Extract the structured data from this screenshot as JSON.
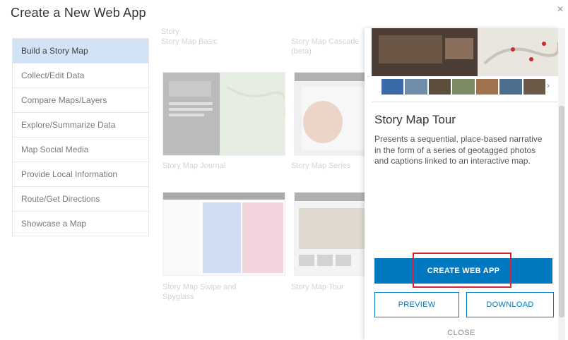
{
  "dialog": {
    "title": "Create a New Web App",
    "close_glyph": "✕"
  },
  "sidebar": {
    "items": [
      {
        "label": "Build a Story Map",
        "active": true
      },
      {
        "label": "Collect/Edit Data"
      },
      {
        "label": "Compare Maps/Layers"
      },
      {
        "label": "Explore/Summarize Data"
      },
      {
        "label": "Map Social Media"
      },
      {
        "label": "Provide Local Information"
      },
      {
        "label": "Route/Get Directions"
      },
      {
        "label": "Showcase a Map"
      }
    ]
  },
  "gallery": {
    "top_captions": [
      "Story Map Basic",
      "Story Map Cascade (beta)"
    ],
    "top_partial": "Story",
    "captions": [
      "Story Map Journal",
      "Story Map Series",
      "Story Map Swipe and Spyglass",
      "Story Map Tour"
    ]
  },
  "detail": {
    "title": "Story Map Tour",
    "description": "Presents a sequential, place-based narrative in the form of a series of geotagged photos and captions linked to an interactive map.",
    "create_label": "CREATE WEB APP",
    "preview_label": "PREVIEW",
    "download_label": "DOWNLOAD",
    "close_label": "CLOSE",
    "strip_arrow": "›"
  },
  "colors": {
    "accent": "#0079c1",
    "highlight": "#d3262f",
    "sidebar_active": "#d2e3f5"
  }
}
